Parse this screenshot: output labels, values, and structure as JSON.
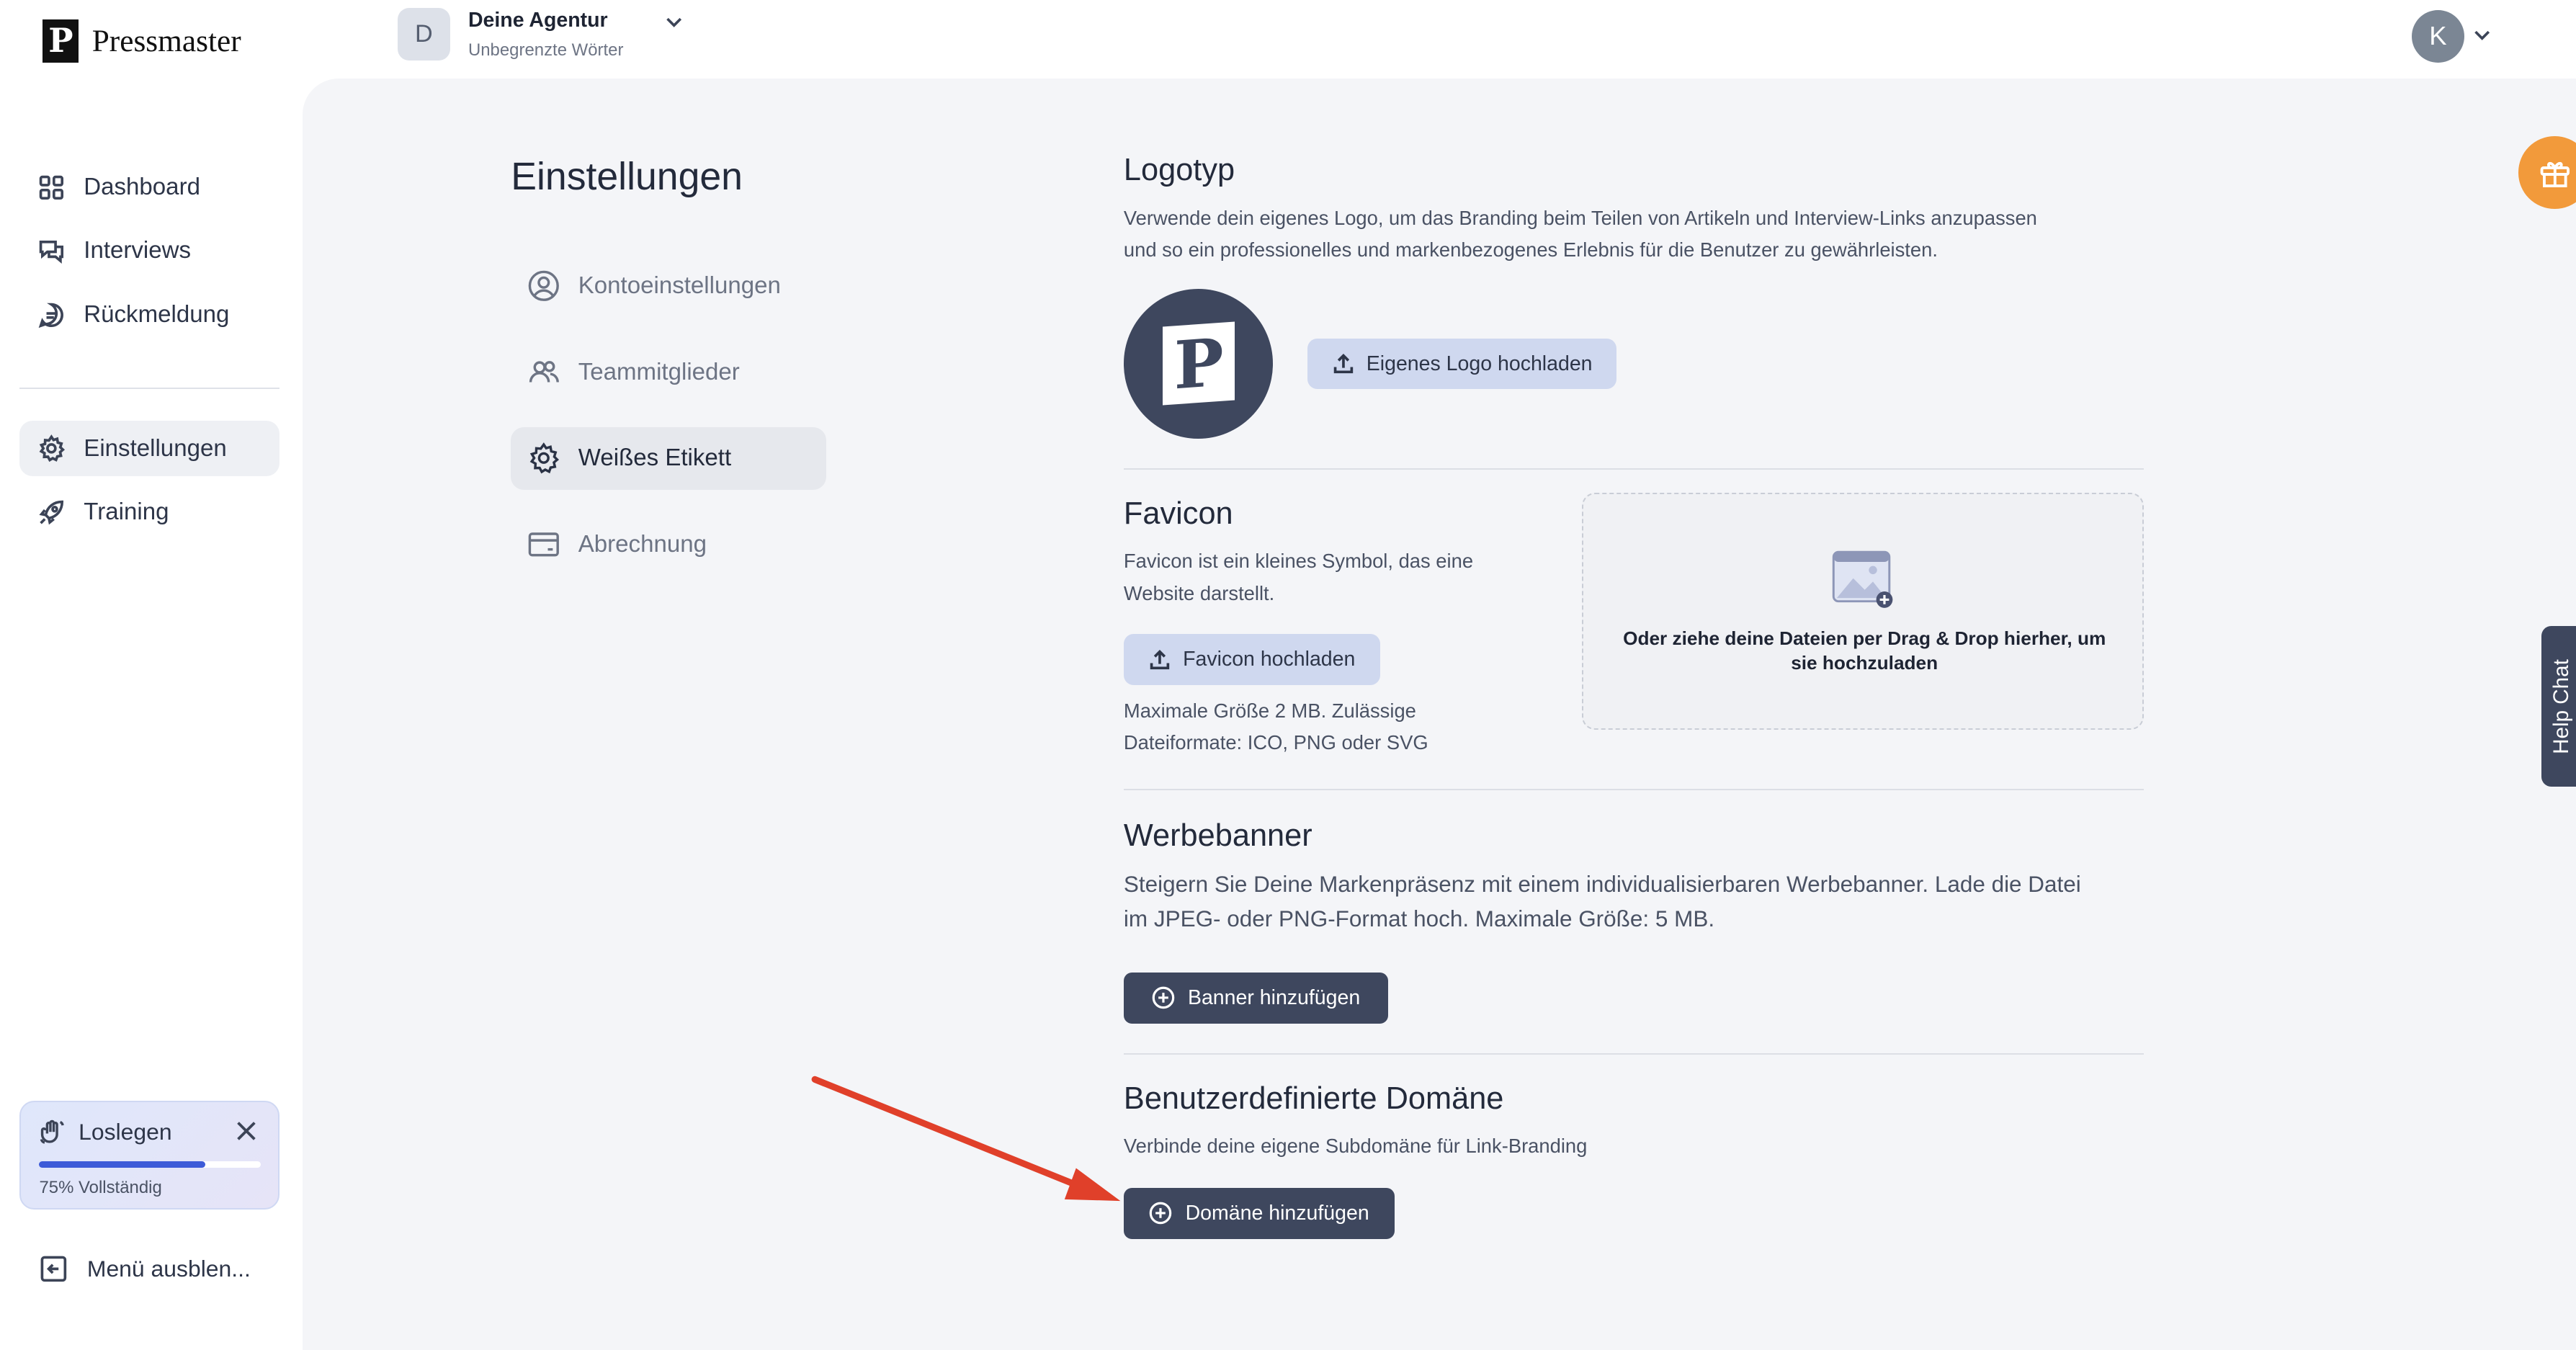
{
  "brand": {
    "mark": "P",
    "name": "Pressmaster"
  },
  "topbar": {
    "agency_initial": "D",
    "agency_name": "Deine Agentur",
    "agency_sub": "Unbegrenzte Wörter",
    "user_initial": "K"
  },
  "sidebar": {
    "items": [
      {
        "label": "Dashboard",
        "icon": "grid-icon"
      },
      {
        "label": "Interviews",
        "icon": "chat-bubbles-icon"
      },
      {
        "label": "Rückmeldung",
        "icon": "feedback-icon"
      },
      {
        "label": "Einstellungen",
        "icon": "gear-icon"
      },
      {
        "label": "Training",
        "icon": "rocket-icon"
      }
    ],
    "getstarted": {
      "label": "Loslegen",
      "progress_text": "75% Vollständig",
      "progress": 0.75
    },
    "hide_menu": "Menü ausblen..."
  },
  "settings": {
    "title": "Einstellungen",
    "subnav": [
      {
        "label": "Kontoeinstellungen"
      },
      {
        "label": "Teammitglieder"
      },
      {
        "label": "Weißes Etikett"
      },
      {
        "label": "Abrechnung"
      }
    ]
  },
  "logotype": {
    "title": "Logotyp",
    "desc_line1": "Verwende dein eigenes Logo, um das Branding beim Teilen von Artikeln und Interview-Links anzupassen",
    "desc_line2": "und so ein professionelles und markenbezogenes Erlebnis für die Benutzer zu gewährleisten.",
    "logo_letter": "P",
    "upload_label": "Eigenes Logo hochladen"
  },
  "favicon": {
    "title": "Favicon",
    "desc_line1": "Favicon ist ein kleines Symbol, das eine",
    "desc_line2": "Website darstellt.",
    "upload_label": "Favicon hochladen",
    "limits_line1": "Maximale Größe 2 MB. Zulässige",
    "limits_line2": "Dateiformate: ICO, PNG oder SVG",
    "dropzone_line1": "Oder ziehe deine Dateien per Drag & Drop hierher, um",
    "dropzone_line2": "sie hochzuladen"
  },
  "banner": {
    "title": "Werbebanner",
    "desc_line1": "Steigern Sie Deine Markenpräsenz mit einem individualisierbaren Werbebanner. Lade die Datei",
    "desc_line2": "im JPEG- oder PNG-Format hoch. Maximale Größe: 5 MB.",
    "button_label": "Banner hinzufügen"
  },
  "domain": {
    "title": "Benutzerdefinierte Domäne",
    "desc": "Verbinde deine eigene Subdomäne für Link-Branding",
    "button_label": "Domäne hinzufügen"
  },
  "widgets": {
    "help_chat": "Help Chat"
  },
  "colors": {
    "primary_dark": "#3e475e",
    "light_button": "#cfd8ef",
    "accent_orange": "#f29a3b",
    "arrow_red": "#e0402a"
  }
}
